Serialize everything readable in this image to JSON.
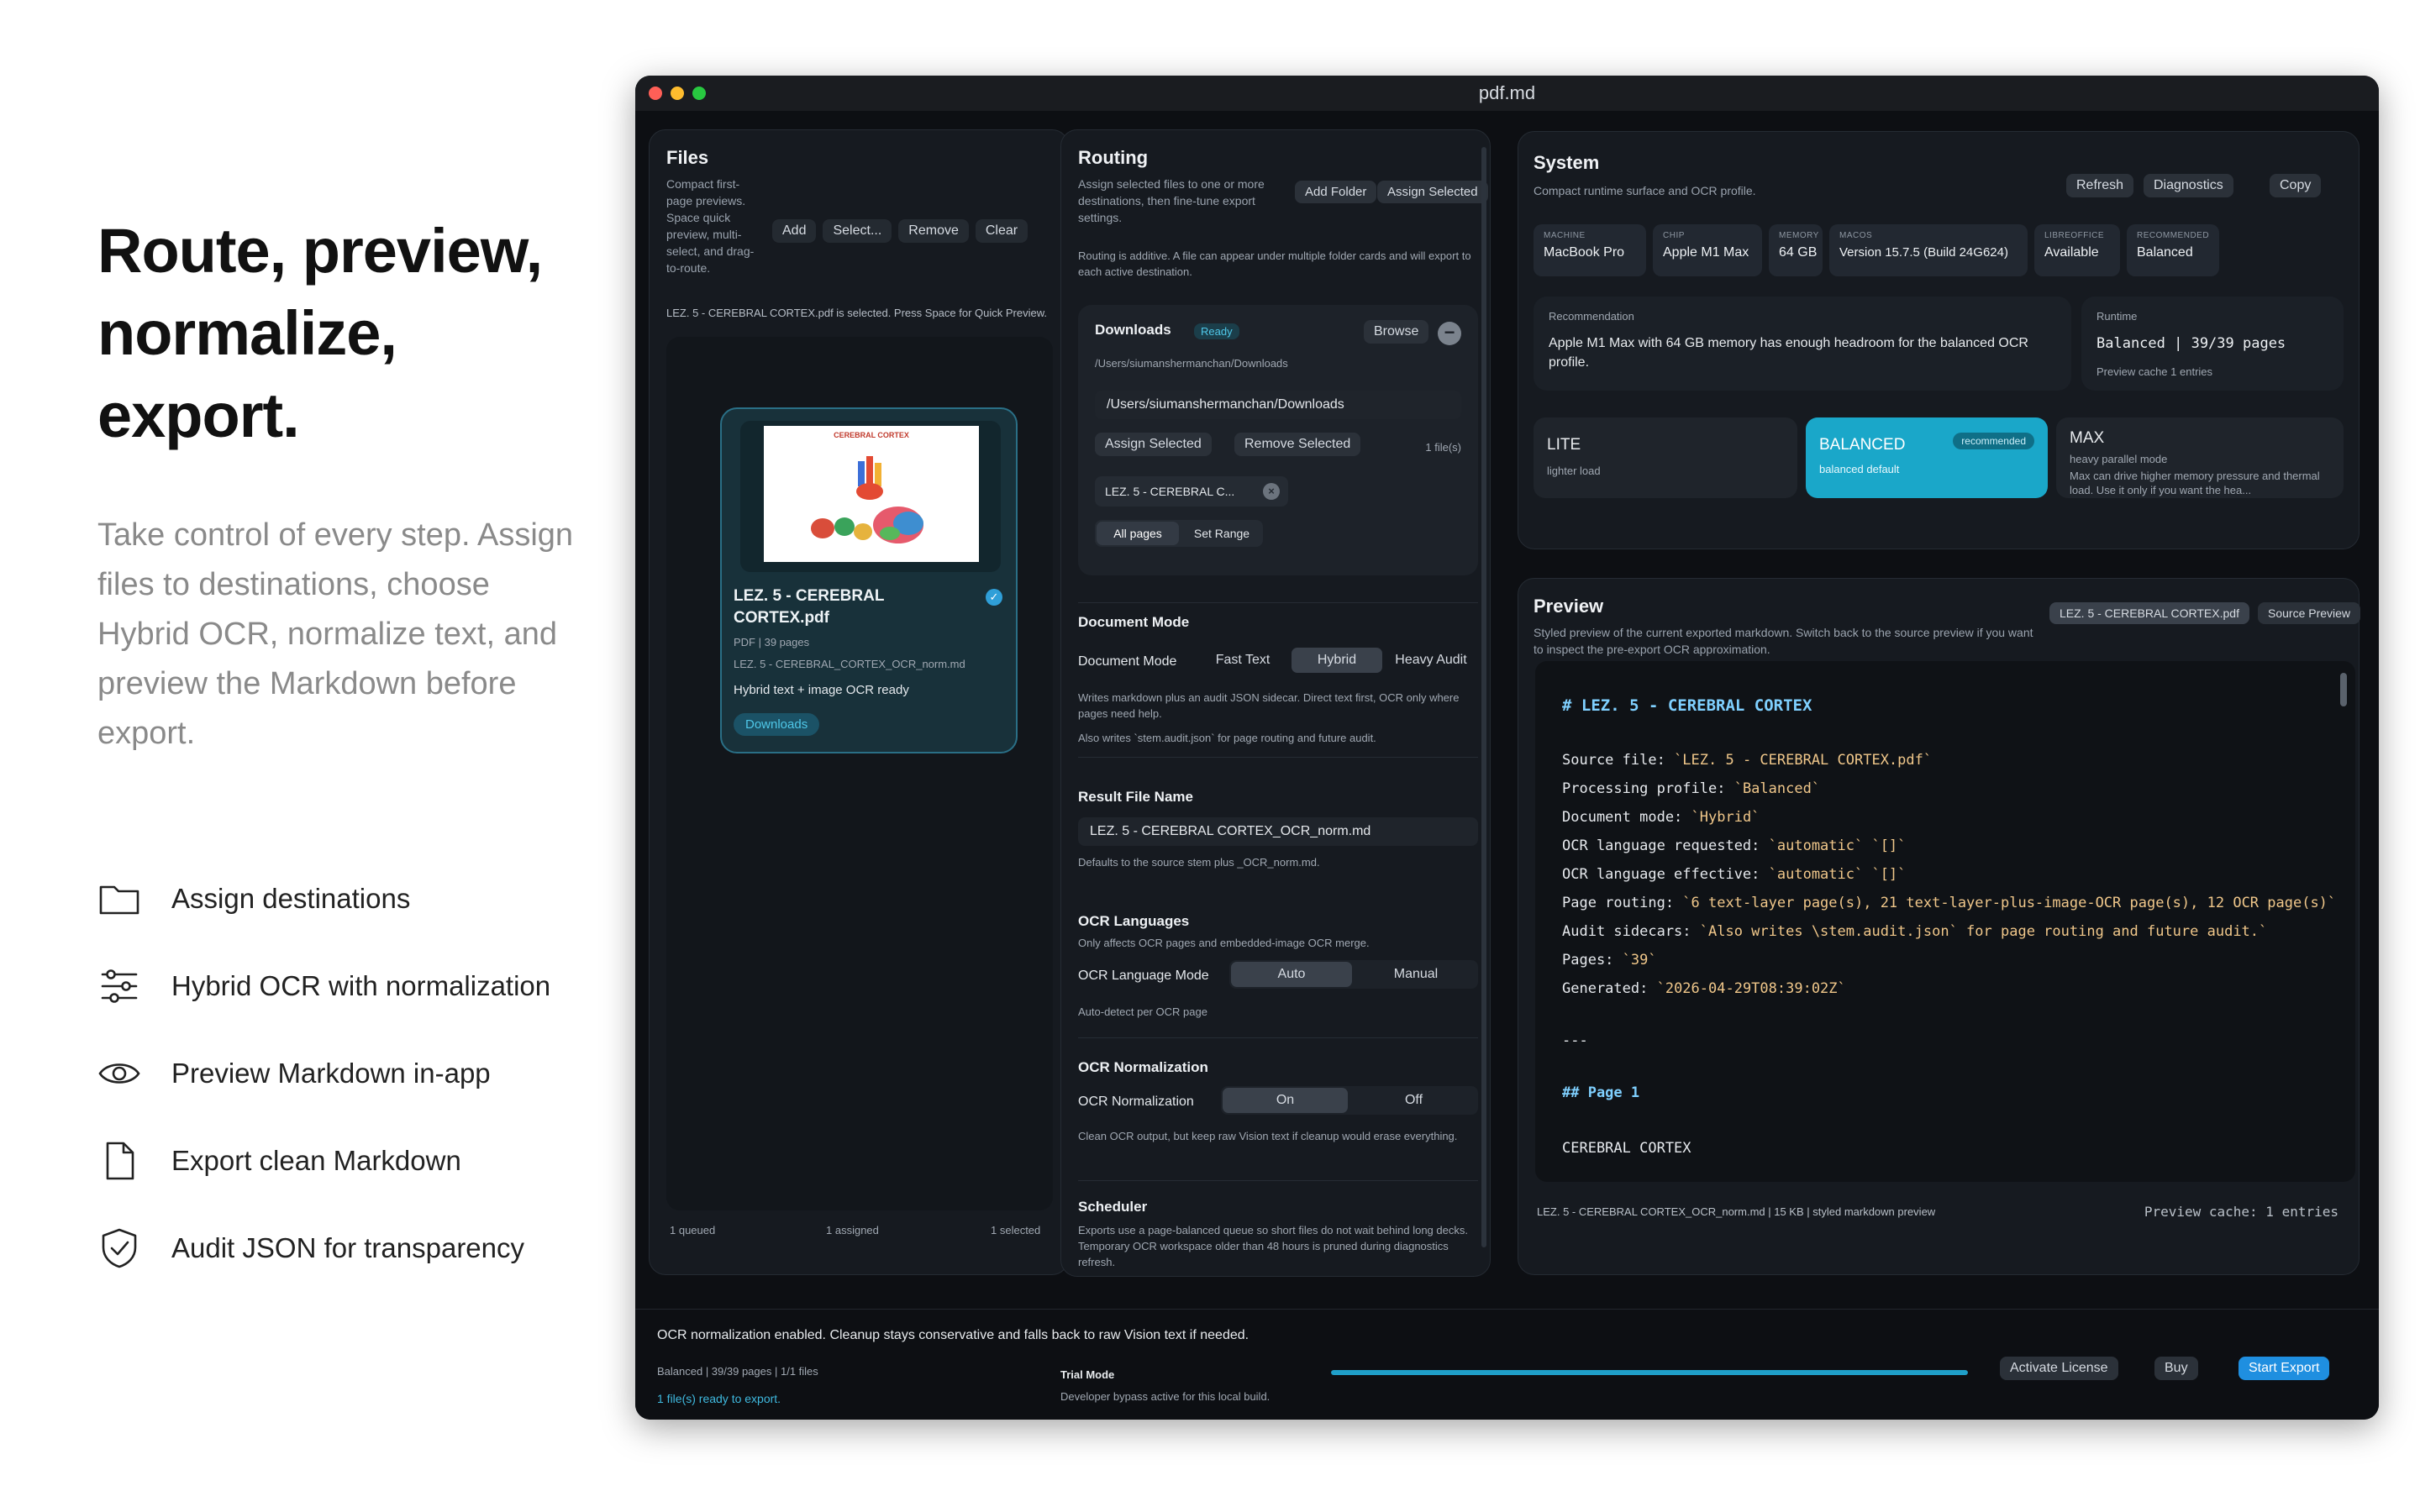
{
  "hero": {
    "title": "Route, preview, normalize, export.",
    "body": "Take control of every step. Assign files to destinations, choose Hybrid OCR, normalize text, and preview the Markdown before export."
  },
  "features": [
    {
      "icon": "folder-icon",
      "label": "Assign destinations"
    },
    {
      "icon": "sliders-icon",
      "label": "Hybrid OCR with normalization"
    },
    {
      "icon": "eye-icon",
      "label": "Preview Markdown in-app"
    },
    {
      "icon": "document-icon",
      "label": "Export clean Markdown"
    },
    {
      "icon": "shield-check-icon",
      "label": "Audit JSON for transparency"
    }
  ],
  "window": {
    "title": "pdf.md",
    "colors": {
      "close": "#ff5f57",
      "minimize": "#febc2e",
      "zoom": "#28c840",
      "accent": "#1f9fc9",
      "balanced": "#1aa7c9"
    }
  },
  "files": {
    "title": "Files",
    "subtitle": "Compact first-page previews. Space quick preview, multi-select, and drag-to-route.",
    "buttons": {
      "add": "Add",
      "select": "Select...",
      "remove": "Remove",
      "clear": "Clear"
    },
    "selection_note": "LEZ. 5 - CEREBRAL CORTEX.pdf is selected. Press Space for Quick Preview.",
    "card": {
      "thumb_title": "CEREBRAL CORTEX",
      "name": "LEZ. 5 - CEREBRAL CORTEX.pdf",
      "meta": "PDF  |  39 pages",
      "output": "LEZ. 5 - CEREBRAL_CORTEX_OCR_norm.md",
      "status": "Hybrid text + image OCR ready",
      "destination": "Downloads"
    },
    "stats": {
      "queued": "1 queued",
      "assigned": "1 assigned",
      "selected": "1 selected"
    }
  },
  "routing": {
    "title": "Routing",
    "subtitle": "Assign selected files to one or more destinations, then fine-tune export settings.",
    "buttons": {
      "add_folder": "Add Folder",
      "assign_selected": "Assign Selected"
    },
    "note": "Routing is additive. A file can appear under multiple folder cards and will export to each active destination.",
    "destination": {
      "name": "Downloads",
      "status": "Ready",
      "browse": "Browse",
      "path_label": "/Users/siumanshermanchan/Downloads",
      "path_value": "/Users/siumanshermanchan/Downloads",
      "assign": "Assign Selected",
      "remove": "Remove Selected",
      "count": "1 file(s)",
      "file_chip": "LEZ. 5 - CEREBRAL C...",
      "all_pages": "All pages",
      "set_range": "Set Range"
    },
    "document_mode": {
      "section": "Document Mode",
      "label": "Document Mode",
      "options": [
        "Fast Text",
        "Hybrid",
        "Heavy Audit"
      ],
      "selected": "Hybrid",
      "help1": "Writes markdown plus an audit JSON sidecar. Direct text first, OCR only where pages need help.",
      "help2": "Also writes `stem.audit.json` for page routing and future audit."
    },
    "result_file": {
      "section": "Result File Name",
      "value": "LEZ. 5 - CEREBRAL CORTEX_OCR_norm.md",
      "help": "Defaults to the source stem plus _OCR_norm.md."
    },
    "ocr_languages": {
      "section": "OCR Languages",
      "help": "Only affects OCR pages and embedded-image OCR merge.",
      "label": "OCR Language Mode",
      "options": [
        "Auto",
        "Manual"
      ],
      "selected": "Auto",
      "note": "Auto-detect per OCR page"
    },
    "ocr_normalization": {
      "section": "OCR Normalization",
      "label": "OCR Normalization",
      "options": [
        "On",
        "Off"
      ],
      "selected": "On",
      "help": "Clean OCR output, but keep raw Vision text if cleanup would erase everything."
    },
    "scheduler": {
      "section": "Scheduler",
      "help": "Exports use a page-balanced queue so short files do not wait behind long decks. Temporary OCR workspace older than 48 hours is pruned during diagnostics refresh."
    }
  },
  "system": {
    "title": "System",
    "subtitle": "Compact runtime surface and OCR profile.",
    "buttons": {
      "refresh": "Refresh",
      "diagnostics": "Diagnostics",
      "copy": "Copy"
    },
    "chips": [
      {
        "k": "MACHINE",
        "v": "MacBook Pro"
      },
      {
        "k": "CHIP",
        "v": "Apple M1 Max"
      },
      {
        "k": "MEMORY",
        "v": "64 GB"
      },
      {
        "k": "MACOS",
        "v": "Version 15.7.5 (Build 24G624)"
      },
      {
        "k": "LIBREOFFICE",
        "v": "Available"
      },
      {
        "k": "RECOMMENDED",
        "v": "Balanced"
      }
    ],
    "recommendation": {
      "label": "Recommendation",
      "text": "Apple M1 Max with 64 GB memory has enough headroom for the balanced OCR profile."
    },
    "runtime": {
      "label": "Runtime",
      "value": "Balanced | 39/39 pages",
      "cache": "Preview cache 1 entries"
    },
    "profiles": {
      "lite": {
        "name": "LITE",
        "desc": "lighter load"
      },
      "balanced": {
        "name": "BALANCED",
        "desc": "balanced default",
        "tag": "recommended"
      },
      "max": {
        "name": "MAX",
        "desc": "heavy parallel mode",
        "note": "Max can drive higher memory pressure and thermal load. Use it only if you want the hea..."
      }
    }
  },
  "preview": {
    "title": "Preview",
    "subtitle": "Styled preview of the current exported markdown. Switch back to the source preview if you want to inspect the pre-export OCR approximation.",
    "file_tab": "LEZ. 5 - CEREBRAL CORTEX.pdf",
    "source_tab": "Source Preview",
    "heading": "# LEZ. 5 - CEREBRAL CORTEX",
    "lines": [
      {
        "k": "Source file: ",
        "v": "`LEZ. 5 - CEREBRAL CORTEX.pdf`"
      },
      {
        "k": "Processing profile: ",
        "v": "`Balanced`"
      },
      {
        "k": "Document mode: ",
        "v": "`Hybrid`"
      },
      {
        "k": "OCR language requested: ",
        "v": "`automatic` `[]`"
      },
      {
        "k": "OCR language effective: ",
        "v": "`automatic` `[]`"
      },
      {
        "k": "Page routing: ",
        "v": "`6 text-layer page(s), 21 text-layer-plus-image-OCR page(s), 12 OCR page(s)`"
      },
      {
        "k": "Audit sidecars: ",
        "v": "`Also writes \\stem.audit.json` for page routing and future audit.`"
      },
      {
        "k": "Pages: ",
        "v": "`39`"
      },
      {
        "k": "Generated: ",
        "v": "`2026-04-29T08:39:02Z`"
      }
    ],
    "rule": "---",
    "page_heading": "## Page 1",
    "page_text": "CEREBRAL CORTEX",
    "footer_left": "LEZ. 5 - CEREBRAL CORTEX_OCR_norm.md | 15 KB | styled markdown preview",
    "footer_right": "Preview cache: 1 entries"
  },
  "footer": {
    "message": "OCR normalization enabled. Cleanup stays conservative and falls back to raw Vision text if needed.",
    "stats": "Balanced | 39/39 pages | 1/1 files",
    "ready": "1 file(s) ready to export.",
    "trial_title": "Trial Mode",
    "trial_desc": "Developer bypass active for this local build.",
    "progress": 1.0,
    "activate": "Activate License",
    "buy": "Buy",
    "start": "Start Export"
  }
}
